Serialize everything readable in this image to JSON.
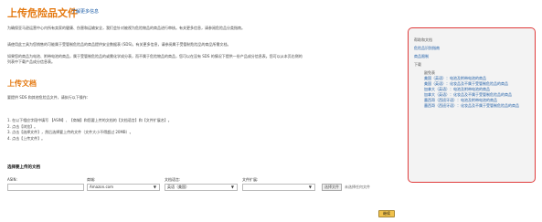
{
  "header": {
    "title": "上传危险品文件",
    "learn_more": "了解更多信息"
  },
  "intro": {
    "p1": "为确保亚马逊运营中心内所有卖家的健康、伤害和运输安全，我们会针对被视为危险物品的商品进行审核。有关更多信息，请参阅危险品分类指南。",
    "p2": "请使用此工具为您销售的可能属于受管制危险品的商品提供安全数据表 (SDS)。有关更多信息，请参阅属于受管制危险品的商品所需文档。",
    "p3": "如果您的商品为电池、附带电池的商品，属于受管制危险品的或需化学成分表，而不属于危险物品的商品，您可以在没有 SDS 的情况下提供一份产品成分信息表。您可以从本页右侧的列表中下载产品成分信息表。"
  },
  "upload": {
    "title": "上传文档",
    "desc": "要提供 SDS 和其他危险品文件，请执行以下操作：",
    "steps": [
      "1. 在以下相应字段中填写 【ASIN】、【商城】和您要上传的文档的【文档语言】和【文件扩展名】。",
      "2. 点击【浏览】。",
      "3. 点击【选择文件】，然后选择要上传的文件（文件大小不得超过 20MB）。",
      "4. 点击【上传文件】。"
    ]
  },
  "form": {
    "title": "选择要上传的文档",
    "asin_label": "ASIN:",
    "asin_value": "",
    "marketplace_label": "商城:",
    "marketplace_value": "Amazon.com",
    "language_label": "文档语言:",
    "language_value": "英语（美国）",
    "extension_label": "文件扩展:",
    "extension_value": "",
    "choose_file": "选择文件",
    "no_file": "未选择任何文件",
    "upload_button": "继续"
  },
  "sidebar": {
    "help_heading": "帮助和文档",
    "help_links": [
      "危险品识别指南",
      "商品限制"
    ],
    "download_heading": "下载",
    "list_heading": "副免表",
    "downloads": [
      "美国（英语）：电池及附带电池的商品",
      "美国（英语）：化妆品及不属于受管制危险品的商品",
      "加拿大（英语）：电池及附带电池的商品",
      "加拿大（英语）：化妆品及不属于受管制危险品的商品",
      "墨西哥（西班牙语）：电池及附带电池的商品",
      "墨西哥（西班牙语）：化妆品及不属于受管制危险品的商品"
    ]
  },
  "colors": {
    "title_orange": "#e47911",
    "link_blue": "#1a5ba6",
    "sidebar_border": "#e03b3b",
    "button_yellow": "#f0c14b"
  }
}
